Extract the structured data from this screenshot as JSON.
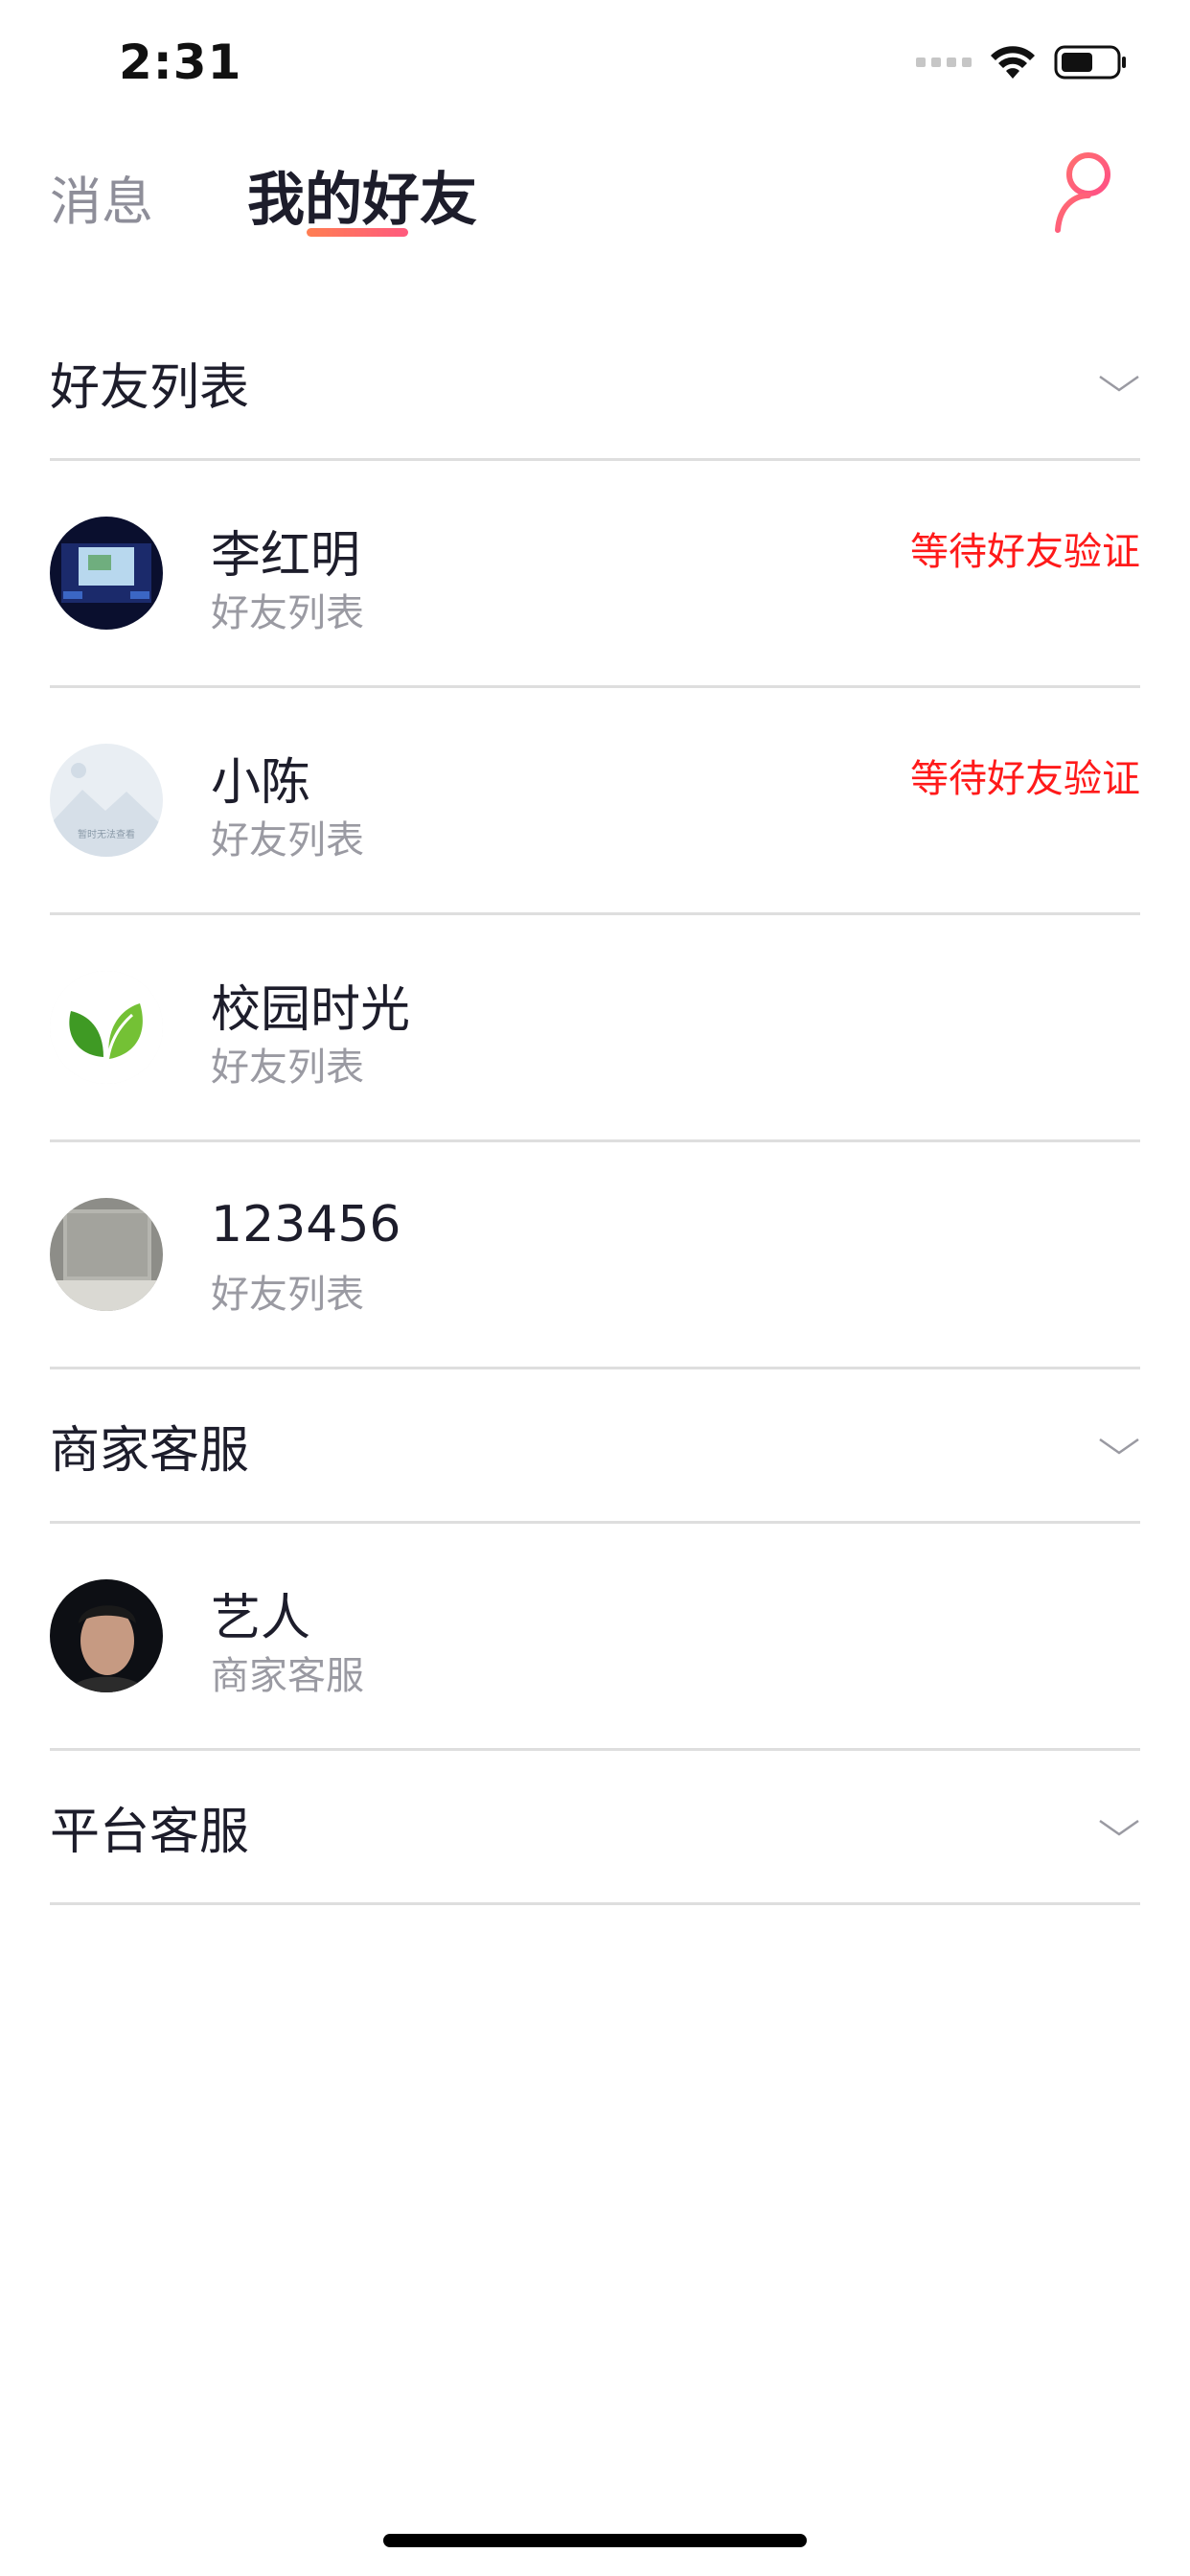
{
  "status_bar": {
    "time": "2:31"
  },
  "nav": {
    "tab_messages": "消息",
    "tab_friends": "我的好友",
    "active_tab": "我的好友",
    "accent_color": "#ff5a7e"
  },
  "groups": [
    {
      "title": "好友列表",
      "friends": [
        {
          "name": "李红明",
          "subtitle": "好友列表",
          "status": "等待好友验证"
        },
        {
          "name": "小陈",
          "subtitle": "好友列表",
          "status": "等待好友验证",
          "avatar_caption": "暂时无法查看"
        },
        {
          "name": "校园时光",
          "subtitle": "好友列表",
          "status": ""
        },
        {
          "name": "123456",
          "subtitle": "好友列表",
          "status": ""
        }
      ]
    },
    {
      "title": "商家客服",
      "friends": [
        {
          "name": "艺人",
          "subtitle": "商家客服",
          "status": ""
        }
      ]
    },
    {
      "title": "平台客服",
      "friends": []
    }
  ],
  "icons": {
    "add_friend": "add-user-icon",
    "chevron": "chevron-down-icon",
    "wifi": "wifi-icon",
    "battery": "battery-icon",
    "signal": "signal-icon"
  },
  "colors": {
    "pending_status": "#ff1a1a",
    "divider": "#dedede"
  }
}
